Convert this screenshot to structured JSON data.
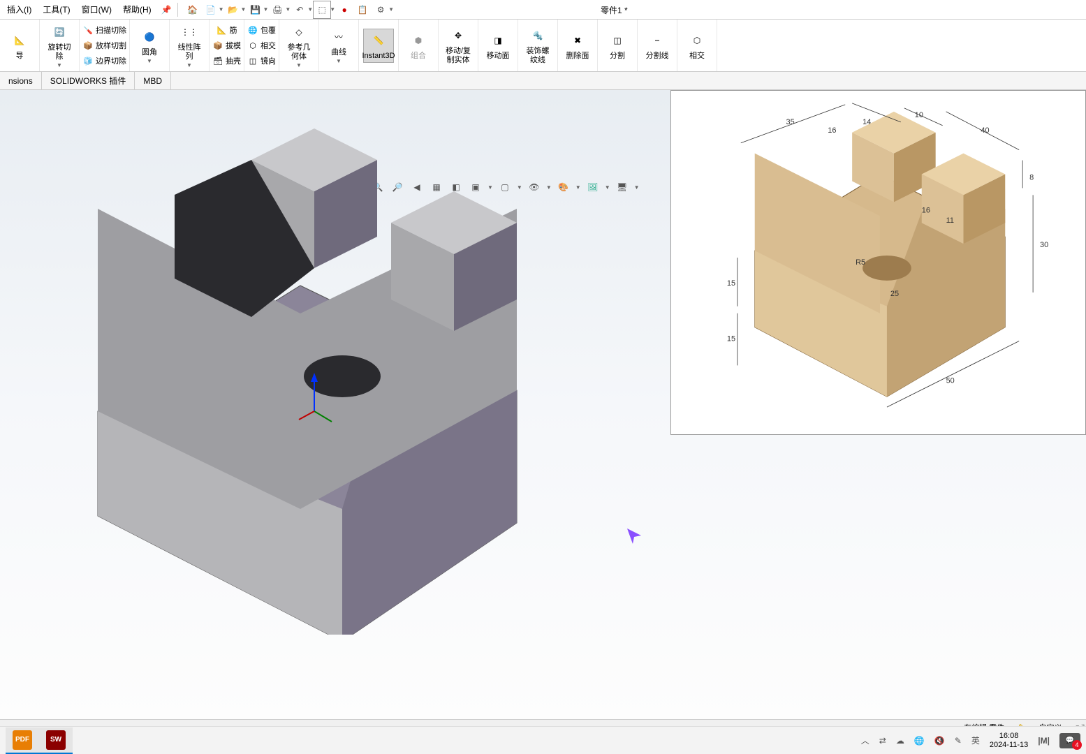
{
  "menu": {
    "insert": "插入(I)",
    "tools": "工具(T)",
    "window": "窗口(W)",
    "help": "帮助(H)"
  },
  "doc_title": "零件1 *",
  "ribbon": {
    "guide": "导",
    "revolve_cut": "旋转切除",
    "sweep_cut": "扫描切除",
    "loft_cut": "放样切割",
    "boundary_cut": "边界切除",
    "fillet": "圆角",
    "linear_pattern": "线性阵列",
    "rib": "筋",
    "draft": "拔模",
    "shell": "抽壳",
    "wrap": "包覆",
    "intersect": "相交",
    "mirror": "镜向",
    "ref_geom": "参考几何体",
    "curve": "曲线",
    "instant3d": "Instant3D",
    "combine": "组合",
    "move_copy": "移动/复制实体",
    "move_face": "移动面",
    "decal": "装饰螺纹线",
    "delete_face": "删除面",
    "split": "分割",
    "split_line": "分割线",
    "intersect2": "相交"
  },
  "tabs": {
    "t1": "nsions",
    "t2": "SOLIDWORKS 插件",
    "t3": "MBD"
  },
  "status": {
    "editing": "在编辑 零件",
    "custom": "自定义"
  },
  "taskbar": {
    "time": "16:08",
    "date": "2024-11-13",
    "ime": "英",
    "notif_count": "4"
  },
  "ref_dims": {
    "d35": "35",
    "d16a": "16",
    "d14": "14",
    "d10": "10",
    "d40": "40",
    "d16b": "16",
    "d11": "11",
    "dR5": "R5",
    "d25": "25",
    "d8": "8",
    "d30": "30",
    "d15a": "15",
    "d15b": "15",
    "d50": "50"
  }
}
